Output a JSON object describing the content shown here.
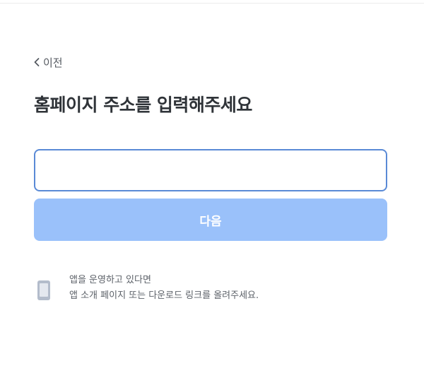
{
  "header": {
    "back_label": "이전"
  },
  "main": {
    "title": "홈페이지 주소를 입력해주세요",
    "url_input": {
      "value": "",
      "placeholder": ""
    },
    "next_button_label": "다음"
  },
  "app_notice": {
    "line1": "앱을 운영하고 있다면",
    "line2": "앱 소개 페이지 또는 다운로드 링크를 올려주세요.",
    "icon": "phone-icon"
  },
  "colors": {
    "input_border": "#5a8ad6",
    "button_background": "#9ac1fa",
    "title_text": "#2f3338",
    "notice_text": "#5c6168",
    "phone_icon": "#b3bccb"
  }
}
